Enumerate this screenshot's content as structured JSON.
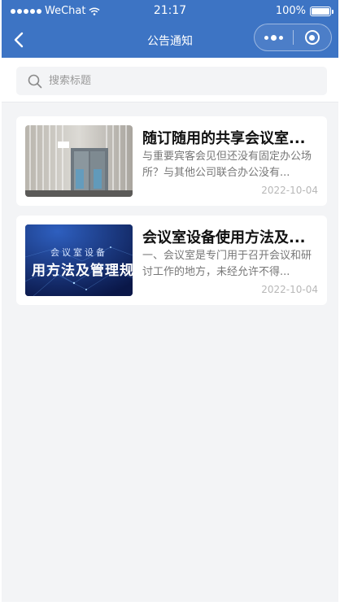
{
  "status_bar": {
    "carrier": "WeChat",
    "time": "21:17",
    "battery": "100%"
  },
  "nav": {
    "title": "公告通知"
  },
  "search": {
    "placeholder": "搜索标题"
  },
  "notices": [
    {
      "title": "随订随用的共享会议室...",
      "desc": "与重要宾客会见但还没有固定办公场所？与其他公司联合办公没有...",
      "date": "2022-10-04",
      "thumb": "office-entrance-photo"
    },
    {
      "title": "会议室设备使用方法及...",
      "desc": "一、会议室是专门用于召开会议和研讨工作的地方，未经允许不得...",
      "date": "2022-10-04",
      "thumb": "meeting-equipment-banner",
      "thumb_line1": "会议室设备",
      "thumb_line2": "用方法及管理规"
    }
  ],
  "colors": {
    "header": "#3d74c4",
    "background": "#f3f4f6",
    "card": "#ffffff",
    "date": "#b8b8b8"
  }
}
